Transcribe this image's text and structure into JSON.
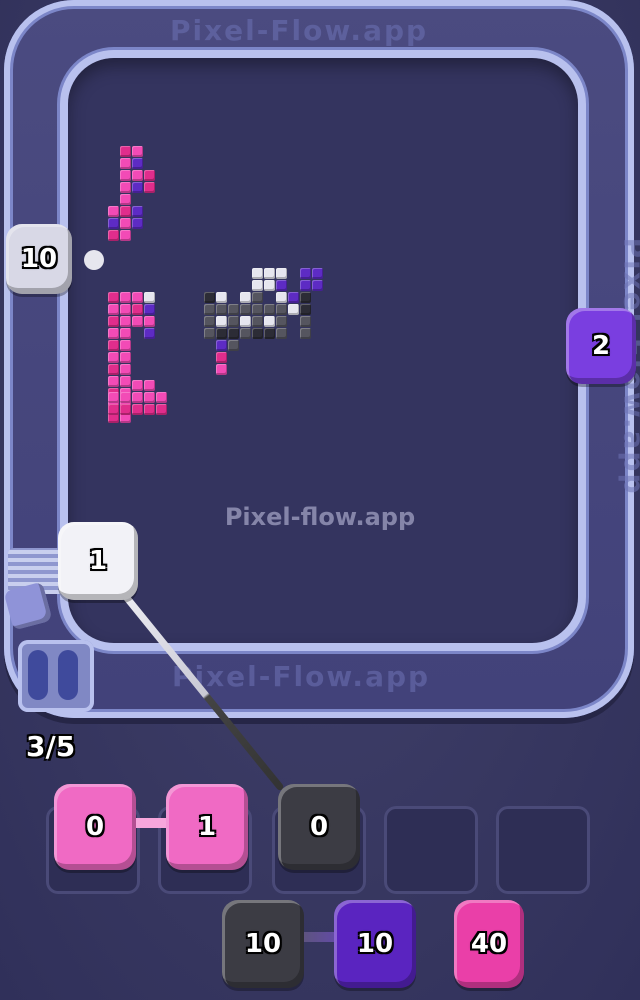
{
  "watermark": "Pixel-flow.app",
  "track_brand": "Pixel-Flow.app",
  "conveyor": {
    "capacity_text": "3/5"
  },
  "track_shooters": [
    {
      "id": "left",
      "count": "10",
      "color": "#d8d8e6"
    },
    {
      "id": "right",
      "count": "2",
      "color": "#7a3ee0"
    },
    {
      "id": "active",
      "count": "1",
      "color": "#f2f2f7"
    }
  ],
  "slots": [
    {
      "count": "0",
      "color": "#f06ac4"
    },
    {
      "count": "1",
      "color": "#f06ac4"
    },
    {
      "count": "0",
      "color": "#3c3c44"
    },
    {
      "count": "",
      "color": ""
    },
    {
      "count": "",
      "color": ""
    }
  ],
  "queue": [
    {
      "count": "10",
      "color": "#3c3c44"
    },
    {
      "count": "10",
      "color": "#5a24c0"
    },
    {
      "count": "40",
      "color": "#ea3fa8"
    }
  ],
  "colors": {
    "pink": "#f24bb6",
    "magenta": "#e02d8c",
    "purple": "#5d2bc4",
    "white": "#e6e6ef",
    "gray": "#55555f",
    "dark": "#2c2c36"
  }
}
